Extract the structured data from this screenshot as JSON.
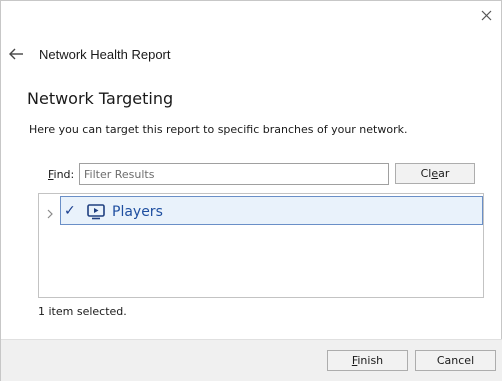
{
  "header": {
    "title": "Network Health Report"
  },
  "section": {
    "title": "Network Targeting",
    "description": "Here you can target this report to specific branches of your network."
  },
  "find": {
    "label_accel": "F",
    "label_rest": "ind:",
    "placeholder": "Filter Results",
    "value": "",
    "clear_accel_pre": "Cl",
    "clear_accel": "e",
    "clear_accel_post": "ar"
  },
  "tree": {
    "items": [
      {
        "label": "Players",
        "checked": true,
        "icon": "player-monitor-icon",
        "checkmark": "✓"
      }
    ]
  },
  "status": {
    "text": "1 item selected."
  },
  "footer": {
    "finish_accel": "F",
    "finish_rest": "inish",
    "cancel_label": "Cancel"
  },
  "colors": {
    "selection_bg": "#e9f2fb",
    "selection_border": "#6a8fc7",
    "accent_text": "#1f4fa0",
    "footer_bg": "#f0f0f0"
  }
}
